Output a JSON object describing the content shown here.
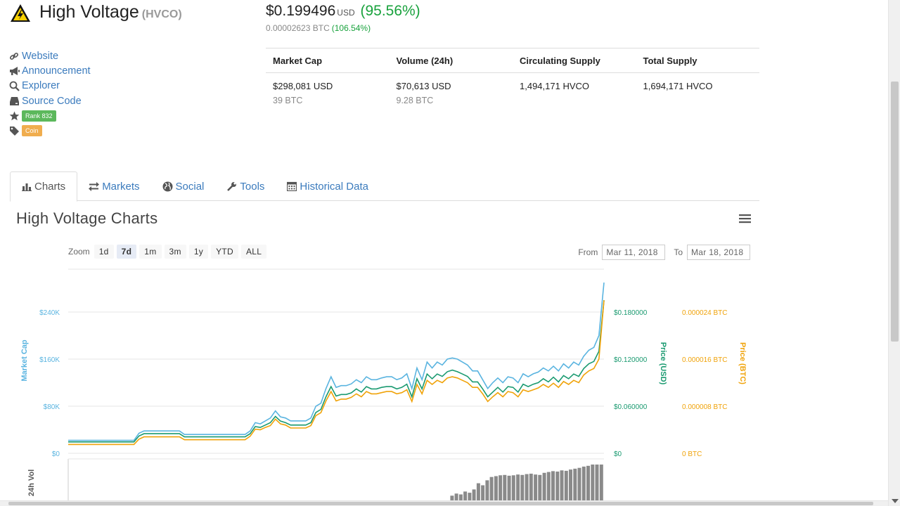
{
  "header": {
    "name": "High Voltage",
    "symbol": "(HVCO)",
    "price_usd": "$0.199496",
    "price_unit": "USD",
    "price_change": "(95.56%)",
    "price_btc": "0.00002623 BTC",
    "price_btc_change": "(106.54%)"
  },
  "links": {
    "website": "Website",
    "announcement": "Announcement",
    "explorer": "Explorer",
    "source_code": "Source Code",
    "rank": "Rank 832",
    "tag": "Coin"
  },
  "stats": {
    "market_cap_label": "Market Cap",
    "volume_label": "Volume (24h)",
    "circulating_label": "Circulating Supply",
    "total_label": "Total Supply",
    "market_cap_usd": "$298,081 USD",
    "market_cap_btc": "39 BTC",
    "volume_usd": "$70,613 USD",
    "volume_btc": "9.28 BTC",
    "circulating": "1,494,171 HVCO",
    "total": "1,694,171 HVCO"
  },
  "tabs": [
    "Charts",
    "Markets",
    "Social",
    "Tools",
    "Historical Data"
  ],
  "chart_header": {
    "title": "High Voltage Charts",
    "zoom_label": "Zoom",
    "zoom_options": [
      "1d",
      "7d",
      "1m",
      "3m",
      "1y",
      "YTD",
      "ALL"
    ],
    "from_label": "From",
    "from_value": "Mar 11, 2018",
    "to_label": "To",
    "to_value": "Mar 18, 2018"
  },
  "colors": {
    "market_cap": "#5ab4e0",
    "price_usd": "#1a9a70",
    "price_btc": "#f0a30a",
    "link": "#3b7bbd",
    "positive": "#19a23d"
  },
  "chart_data": {
    "type": "line",
    "x_range": [
      "Mar 11, 2018",
      "Mar 18, 2018"
    ],
    "y_axes": {
      "market_cap": {
        "label": "Market Cap",
        "ticks": [
          "$0",
          "$80K",
          "$160K",
          "$240K"
        ],
        "ylim": [
          0,
          240000
        ]
      },
      "price_usd": {
        "label": "Price (USD)",
        "ticks": [
          "$0",
          "$0.060000",
          "$0.120000",
          "$0.180000"
        ],
        "ylim": [
          0,
          0.18
        ]
      },
      "price_btc": {
        "label": "Price (BTC)",
        "ticks": [
          "0 BTC",
          "0.000008 BTC",
          "0.000016 BTC",
          "0.000024 BTC"
        ],
        "ylim": [
          0,
          2.4e-05
        ]
      }
    },
    "volume_axis_label": "24h Vol",
    "grid": true,
    "series": [
      {
        "name": "Market Cap",
        "values": [
          22000,
          22000,
          22000,
          22000,
          22000,
          22000,
          22000,
          22000,
          22000,
          22000,
          22000,
          22000,
          22000,
          22000,
          34000,
          38000,
          38000,
          38000,
          38000,
          38000,
          38000,
          38000,
          38000,
          32000,
          32000,
          32000,
          32000,
          32000,
          32000,
          32000,
          32000,
          32000,
          32000,
          32000,
          32000,
          32000,
          38000,
          52000,
          50000,
          55000,
          60000,
          72000,
          62000,
          60000,
          55000,
          55000,
          55000,
          55000,
          60000,
          80000,
          85000,
          110000,
          130000,
          112000,
          115000,
          115000,
          118000,
          125000,
          120000,
          130000,
          125000,
          125000,
          128000,
          130000,
          130000,
          125000,
          128000,
          135000,
          110000,
          145000,
          125000,
          155000,
          145000,
          155000,
          150000,
          160000,
          162000,
          160000,
          155000,
          150000,
          140000,
          140000,
          125000,
          110000,
          120000,
          128000,
          120000,
          130000,
          128000,
          120000,
          135000,
          130000,
          135000,
          138000,
          145000,
          140000,
          148000,
          140000,
          152000,
          145000,
          155000,
          150000,
          165000,
          175000,
          180000,
          200000,
          290000
        ]
      },
      {
        "name": "Price (USD)",
        "values": [
          0.0145,
          0.0145,
          0.0145,
          0.0145,
          0.0145,
          0.0145,
          0.0145,
          0.0145,
          0.0145,
          0.0145,
          0.0145,
          0.0145,
          0.0145,
          0.0145,
          0.022,
          0.025,
          0.025,
          0.025,
          0.025,
          0.025,
          0.025,
          0.025,
          0.025,
          0.021,
          0.021,
          0.021,
          0.021,
          0.021,
          0.021,
          0.021,
          0.021,
          0.021,
          0.021,
          0.021,
          0.021,
          0.021,
          0.025,
          0.034,
          0.033,
          0.036,
          0.039,
          0.047,
          0.041,
          0.039,
          0.036,
          0.036,
          0.036,
          0.036,
          0.039,
          0.052,
          0.056,
          0.072,
          0.085,
          0.073,
          0.075,
          0.075,
          0.077,
          0.082,
          0.078,
          0.085,
          0.082,
          0.082,
          0.084,
          0.085,
          0.085,
          0.082,
          0.084,
          0.088,
          0.072,
          0.095,
          0.082,
          0.101,
          0.095,
          0.101,
          0.098,
          0.104,
          0.106,
          0.104,
          0.101,
          0.098,
          0.091,
          0.091,
          0.082,
          0.072,
          0.078,
          0.084,
          0.078,
          0.085,
          0.084,
          0.078,
          0.088,
          0.085,
          0.088,
          0.09,
          0.095,
          0.091,
          0.097,
          0.091,
          0.099,
          0.095,
          0.101,
          0.098,
          0.108,
          0.114,
          0.117,
          0.13,
          0.195
        ]
      },
      {
        "name": "Price (BTC)",
        "values": [
          1.5e-06,
          1.5e-06,
          1.5e-06,
          1.5e-06,
          1.5e-06,
          1.5e-06,
          1.5e-06,
          1.5e-06,
          1.5e-06,
          1.5e-06,
          1.5e-06,
          1.5e-06,
          1.5e-06,
          1.5e-06,
          2.4e-06,
          2.8e-06,
          2.8e-06,
          2.8e-06,
          2.8e-06,
          2.8e-06,
          2.8e-06,
          2.8e-06,
          2.8e-06,
          2.3e-06,
          2.3e-06,
          2.3e-06,
          2.3e-06,
          2.3e-06,
          2.3e-06,
          2.3e-06,
          2.3e-06,
          2.3e-06,
          2.3e-06,
          2.3e-06,
          2.3e-06,
          2.3e-06,
          2.9e-06,
          4.1e-06,
          4e-06,
          4.4e-06,
          4.7e-06,
          5.8e-06,
          5e-06,
          4.8e-06,
          4.3e-06,
          4.3e-06,
          4.3e-06,
          4.3e-06,
          4.7e-06,
          6.4e-06,
          6.9e-06,
          8.9e-06,
          1.05e-05,
          8.9e-06,
          9.2e-06,
          9.2e-06,
          9.5e-06,
          1.01e-05,
          9.6e-06,
          1.05e-05,
          1.01e-05,
          1.01e-05,
          1.03e-05,
          1.05e-05,
          1.05e-05,
          1.01e-05,
          1.03e-05,
          1.08e-05,
          8.8e-06,
          1.17e-05,
          1.01e-05,
          1.24e-05,
          1.17e-05,
          1.24e-05,
          1.2e-05,
          1.28e-05,
          1.3e-05,
          1.28e-05,
          1.24e-05,
          1.2e-05,
          1.12e-05,
          1.12e-05,
          1.01e-05,
          8.8e-06,
          9.6e-06,
          1.03e-05,
          9.6e-06,
          1.05e-05,
          1.03e-05,
          9.6e-06,
          1.08e-05,
          1.05e-05,
          1.08e-05,
          1.11e-05,
          1.17e-05,
          1.12e-05,
          1.19e-05,
          1.12e-05,
          1.22e-05,
          1.17e-05,
          1.24e-05,
          1.2e-05,
          1.33e-05,
          1.4e-05,
          1.44e-05,
          1.6e-05,
          2.6e-05
        ]
      }
    ],
    "volume_values": [
      0,
      0,
      0,
      0,
      0,
      0,
      0,
      0,
      0,
      0,
      0,
      0,
      0,
      0,
      0,
      0,
      0,
      0,
      0,
      0,
      0,
      0,
      0,
      0,
      0,
      0,
      0,
      0,
      0,
      0,
      0,
      0,
      0,
      0,
      0,
      0,
      0,
      0,
      0,
      0,
      0,
      0,
      0,
      0,
      0,
      0,
      0,
      0,
      0,
      0,
      0,
      0,
      0,
      0,
      0,
      0,
      0,
      0,
      0,
      0,
      0,
      0,
      0,
      0,
      0,
      0,
      0,
      0,
      0,
      0,
      0,
      0,
      0,
      0,
      0,
      0,
      0,
      0,
      0,
      0,
      0,
      0,
      0,
      0,
      0,
      0,
      0.12,
      0.25,
      0.3,
      0.28,
      0.35,
      0.32,
      0.4,
      0.55,
      0.5,
      0.62,
      0.7,
      0.72,
      0.74,
      0.75,
      0.73,
      0.74,
      0.76,
      0.75,
      0.77,
      0.78,
      0.76,
      0.75,
      0.8,
      0.82,
      0.84,
      0.83,
      0.86,
      0.85,
      0.88,
      0.9,
      0.92,
      0.95,
      0.97,
      1.0,
      1.0,
      1.0
    ]
  }
}
